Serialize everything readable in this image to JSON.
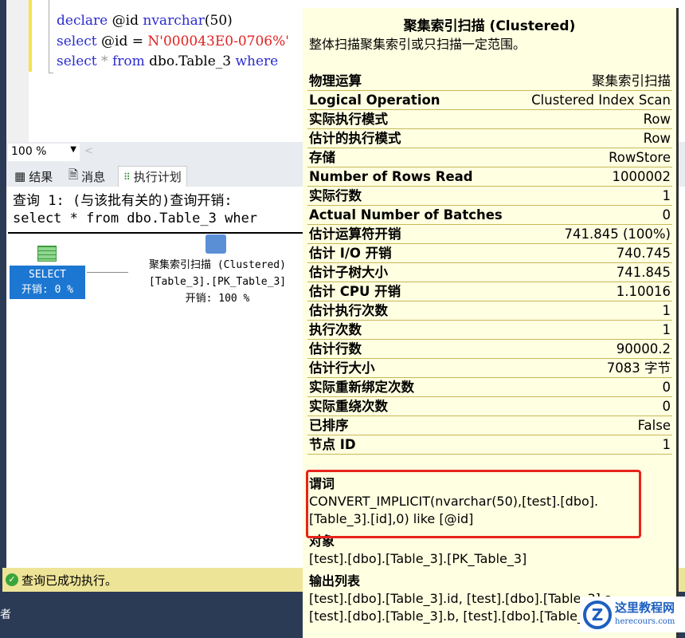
{
  "editor": {
    "line1": [
      "declare",
      " @id ",
      "nvarchar",
      "(50)"
    ],
    "line2": [
      "select",
      " @id = ",
      "N'000043E0-0706%'"
    ],
    "line3": [
      "select",
      " * ",
      "from",
      " dbo.Table_3 ",
      "where"
    ]
  },
  "zoom": {
    "value": "100 %"
  },
  "tabs": [
    "结果",
    "消息",
    "执行计划"
  ],
  "plan": {
    "query_header": "查询 1: (与该批有关的)查询开销:",
    "query_text": "select * from dbo.Table_3 wher",
    "select_node": {
      "label": "SELECT",
      "cost": "开销: 0 %"
    },
    "scan_node": {
      "label": "聚集索引扫描 (Clustered)",
      "object": "[Table_3].[PK_Table_3]",
      "cost": "开销: 100 %"
    }
  },
  "status": {
    "text": "查询已成功执行。"
  },
  "left_fragment": "者",
  "tooltip": {
    "title": "聚集索引扫描 (Clustered)",
    "subtitle": "整体扫描聚集索引或只扫描一定范围。",
    "rows": [
      {
        "k": "物理运算",
        "v": "聚集索引扫描"
      },
      {
        "k": "Logical Operation",
        "v": "Clustered Index Scan"
      },
      {
        "k": "实际执行模式",
        "v": "Row"
      },
      {
        "k": "估计的执行模式",
        "v": "Row"
      },
      {
        "k": "存储",
        "v": "RowStore"
      },
      {
        "k": "Number of Rows Read",
        "v": "1000002"
      },
      {
        "k": "实际行数",
        "v": "1"
      },
      {
        "k": "Actual Number of Batches",
        "v": "0"
      },
      {
        "k": "估计运算符开销",
        "v": "741.845 (100%)"
      },
      {
        "k": "估计 I/O 开销",
        "v": "740.745"
      },
      {
        "k": "估计子树大小",
        "v": "741.845"
      },
      {
        "k": "估计 CPU 开销",
        "v": "1.10016"
      },
      {
        "k": "估计执行次数",
        "v": "1"
      },
      {
        "k": "执行次数",
        "v": "1"
      },
      {
        "k": "估计行数",
        "v": "90000.2"
      },
      {
        "k": "估计行大小",
        "v": "7083 字节"
      },
      {
        "k": "实际重新绑定次数",
        "v": "0"
      },
      {
        "k": "实际重绕次数",
        "v": "0"
      },
      {
        "k": "已排序",
        "v": "False"
      },
      {
        "k": "节点 ID",
        "v": "1"
      }
    ],
    "predicate": {
      "h": "谓词",
      "l1": "CONVERT_IMPLICIT(nvarchar(50),[test].[dbo].",
      "l2": "[Table_3].[id],0) like [@id]"
    },
    "object": {
      "h": "对象",
      "l1": "[test].[dbo].[Table_3].[PK_Table_3]"
    },
    "output": {
      "h": "输出列表",
      "l1": "[test].[dbo].[Table_3].id, [test].[dbo].[Table_3].a,",
      "l2": "[test].[dbo].[Table_3].b, [test].[dbo].[Table_3].c"
    }
  },
  "watermark": {
    "name": "这里教程网",
    "url": "herecours.com"
  },
  "colors": {
    "highlight": "#e8231c",
    "tooltip_bg": "#ffffe1",
    "select_node": "#1c77d2",
    "status_bg": "#eee497"
  }
}
